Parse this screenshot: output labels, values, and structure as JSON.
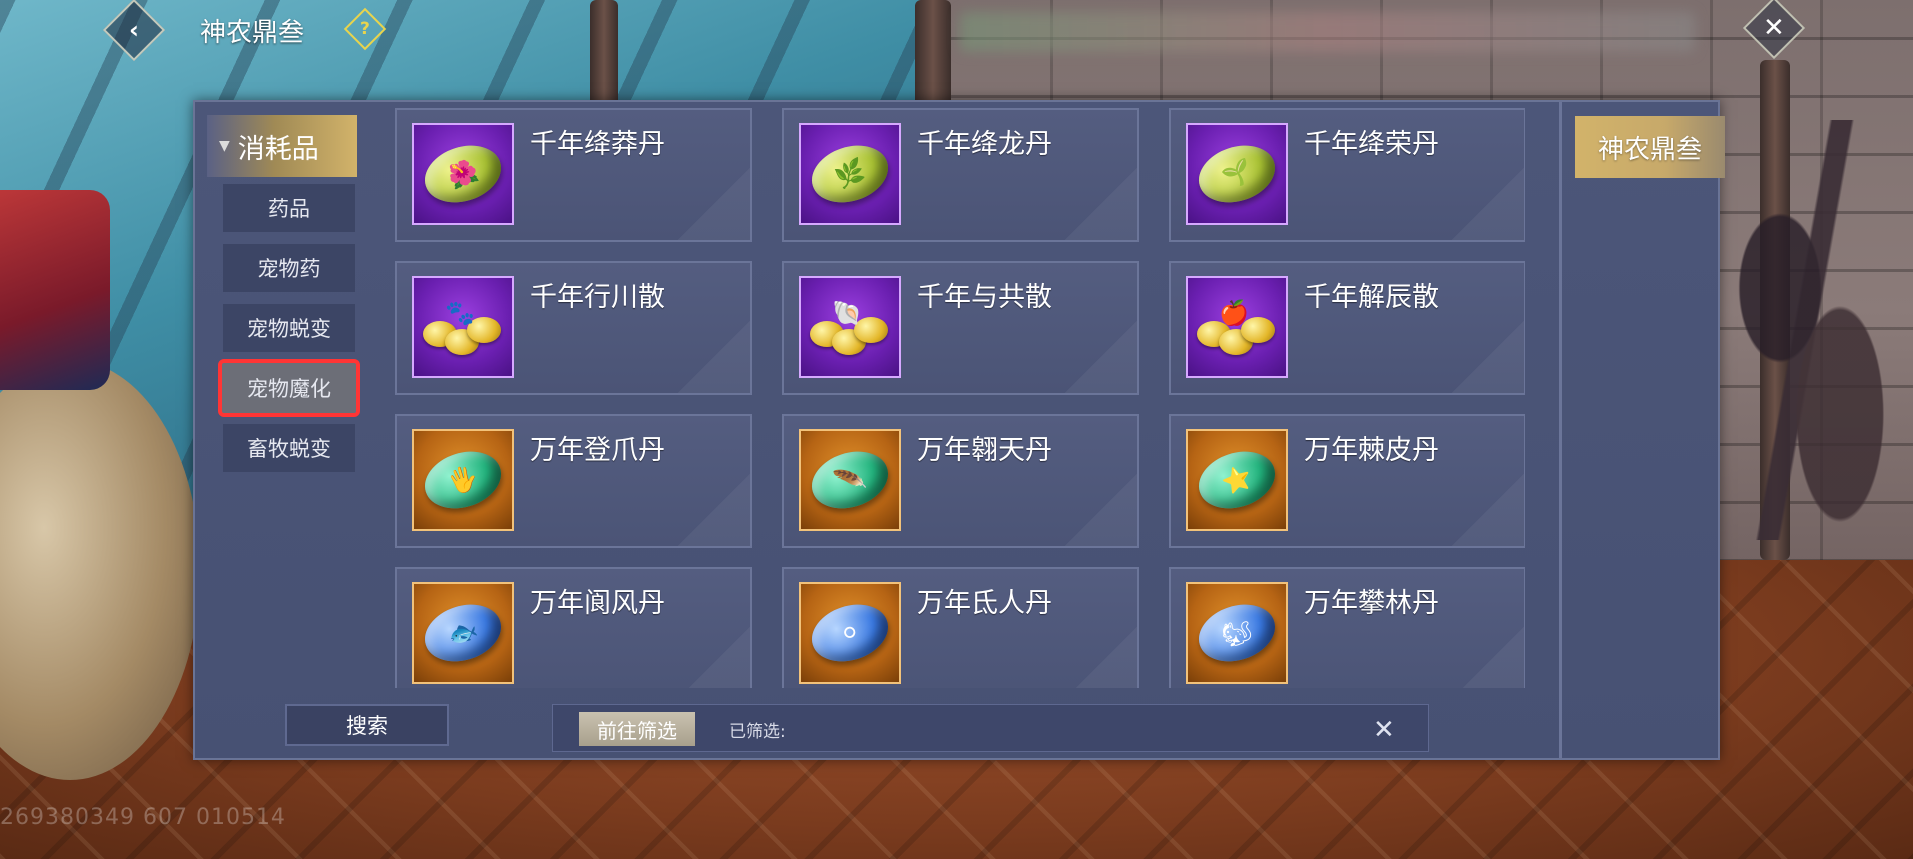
{
  "window": {
    "title": "神农鼎叁",
    "back_icon": "‹",
    "help_icon": "?",
    "close_icon": "✕"
  },
  "category": {
    "header_label": "消耗品",
    "items": [
      {
        "label": "药品"
      },
      {
        "label": "宠物药"
      },
      {
        "label": "宠物蜕变"
      },
      {
        "label": "宠物魔化"
      },
      {
        "label": "畜牧蜕变"
      }
    ],
    "selected": "宠物魔化"
  },
  "items": [
    {
      "name": "千年绛莽丹",
      "rarity": "purple",
      "icon": "green-pill-icon",
      "glyph": "🌺"
    },
    {
      "name": "千年绛龙丹",
      "rarity": "purple",
      "icon": "green-pill-icon",
      "glyph": "🌿"
    },
    {
      "name": "千年绛荣丹",
      "rarity": "purple",
      "icon": "green-pill-icon",
      "glyph": "🌱"
    },
    {
      "name": "千年行川散",
      "rarity": "purple",
      "icon": "gold-coins-icon",
      "glyph": "🐾"
    },
    {
      "name": "千年与共散",
      "rarity": "purple",
      "icon": "gold-coins-icon",
      "glyph": "🐚"
    },
    {
      "name": "千年解辰散",
      "rarity": "purple",
      "icon": "gold-coins-icon",
      "glyph": "🍎"
    },
    {
      "name": "万年登爪丹",
      "rarity": "orange",
      "icon": "teal-pill-icon",
      "glyph": "🖐"
    },
    {
      "name": "万年翱天丹",
      "rarity": "orange",
      "icon": "teal-pill-icon",
      "glyph": "🪶"
    },
    {
      "name": "万年棘皮丹",
      "rarity": "orange",
      "icon": "teal-pill-icon",
      "glyph": "⭐"
    },
    {
      "name": "万年阆风丹",
      "rarity": "orange",
      "icon": "blue-pill-icon",
      "glyph": "🐟"
    },
    {
      "name": "万年氐人丹",
      "rarity": "orange",
      "icon": "blue-pill-icon",
      "glyph": "⚪"
    },
    {
      "name": "万年攀林丹",
      "rarity": "orange",
      "icon": "blue-pill-icon",
      "glyph": "🐿"
    }
  ],
  "right_tab": {
    "label": "神农鼎叁"
  },
  "bottom": {
    "search_label": "搜索",
    "goto_filter_label": "前往筛选",
    "filtered_label": "已筛选:",
    "clear_icon": "✕"
  },
  "watermark": "269380349 607 010514",
  "colors": {
    "panel_bg": "#4c5679",
    "card_border": "#6b7599",
    "accent_gold": "#d2b36a",
    "selection_red": "#ff3535",
    "rarity_purple": "#6a1fb0",
    "rarity_orange": "#b66414"
  }
}
